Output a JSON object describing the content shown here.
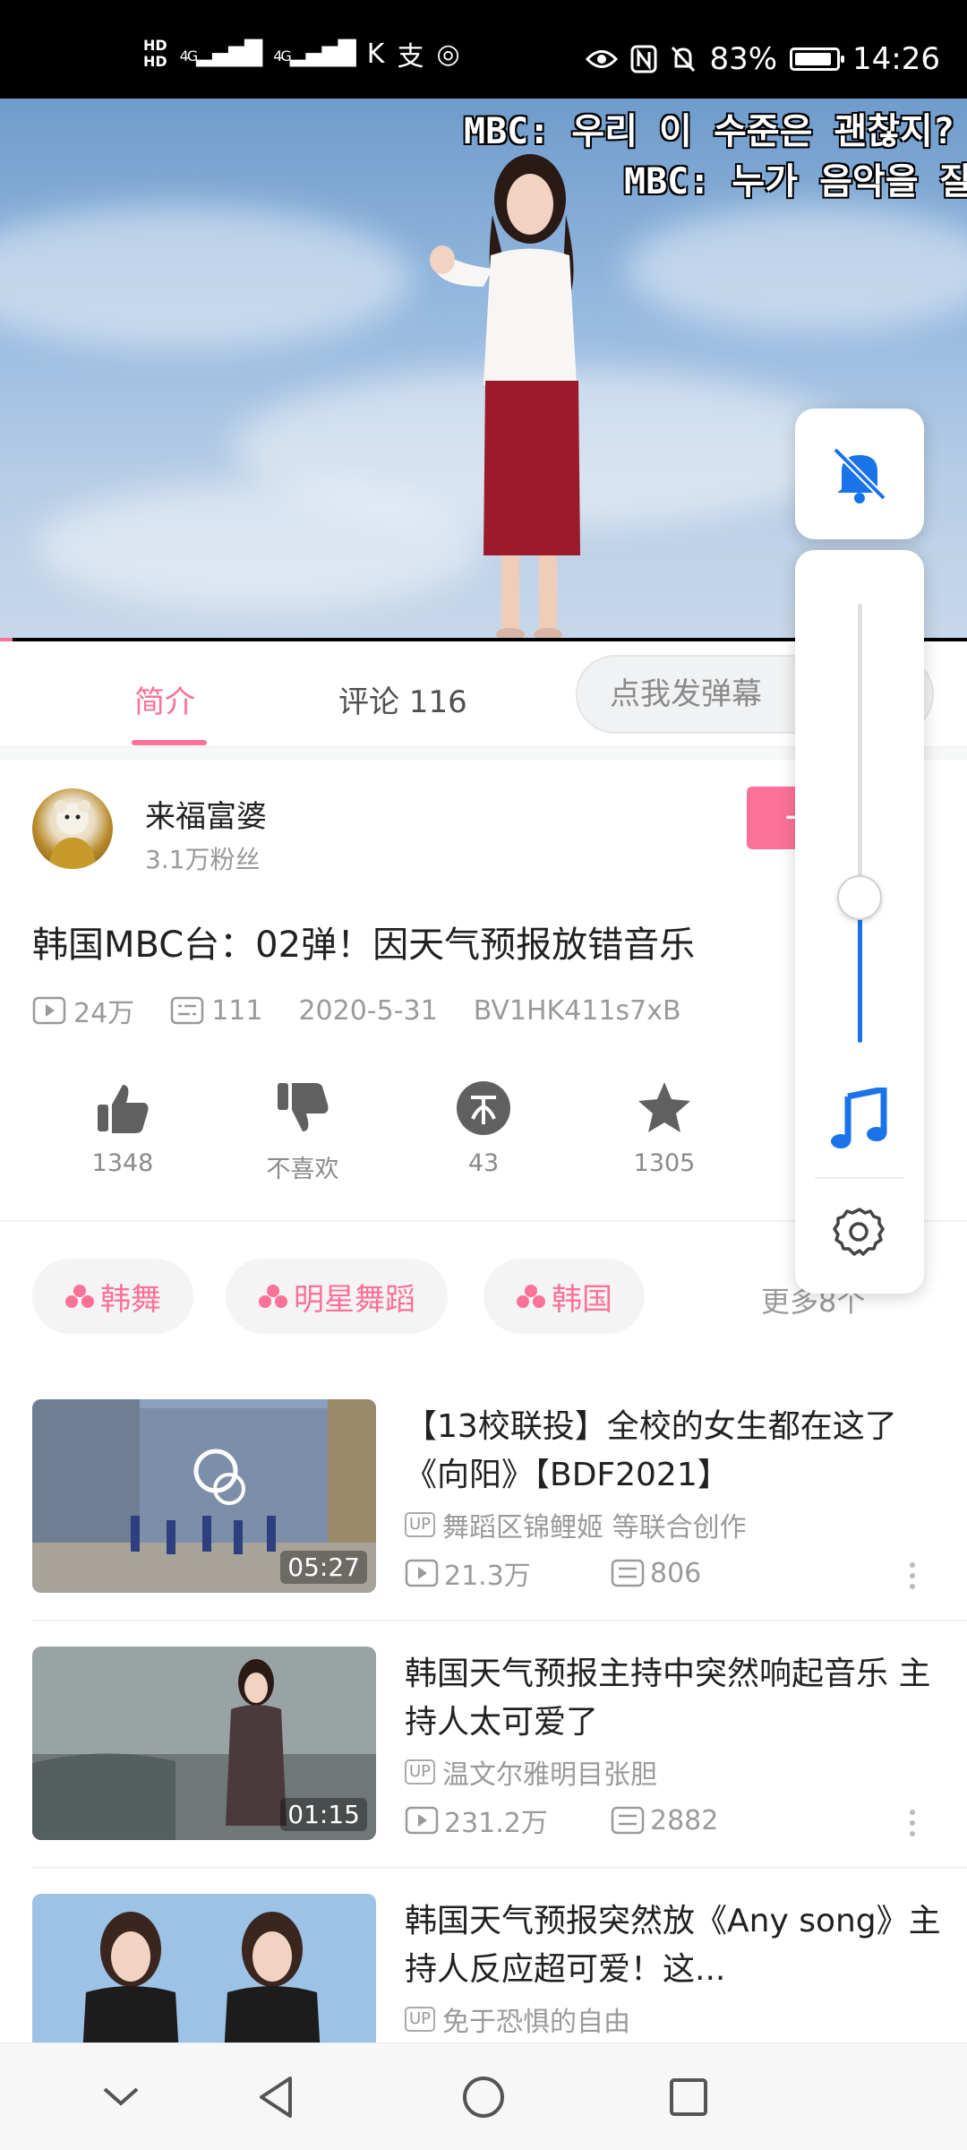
{
  "status_bar": {
    "hd1": "HD",
    "hd2": "HD",
    "net1": "4G",
    "net2": "4G",
    "battery_percent": "83%",
    "time": "14:26"
  },
  "player": {
    "subtitle_line1": "MBC: 우리 이 수준은 괜찮지?",
    "subtitle_line2": "MBC: 누가 음악을 잘",
    "progress_fraction": 0.013
  },
  "tabs": {
    "intro": "简介",
    "comments": "评论 116",
    "danmaku_placeholder": "点我发弹幕"
  },
  "uploader": {
    "name": "来福富婆",
    "fans": "3.1万粉丝",
    "follow_label": "+"
  },
  "video": {
    "title": "韩国MBC台：02弹！因天气预报放错音乐",
    "views": "24万",
    "danmaku": "111",
    "date": "2020-5-31",
    "bvid": "BV1HK411s7xB"
  },
  "actions": {
    "like": "1348",
    "dislike": "不喜欢",
    "coin": "43",
    "favorite": "1305"
  },
  "tags": [
    "韩舞",
    "明星舞蹈",
    "韩国"
  ],
  "more_tags": "更多8个",
  "recommendations": [
    {
      "title": "【13校联投】全校的女生都在这了《向阳》【BDF2021】",
      "up": "舞蹈区锦鲤姬 等联合创作",
      "views": "21.3万",
      "danmaku": "806",
      "duration": "05:27"
    },
    {
      "title": "韩国天气预报主持中突然响起音乐 主持人太可爱了",
      "up": "温文尔雅明目张胆",
      "views": "231.2万",
      "danmaku": "2882",
      "duration": "01:15"
    },
    {
      "title": "韩国天气预报突然放《Any song》主持人反应超可爱！这...",
      "up": "免于恐惧的自由",
      "views": "",
      "danmaku": "",
      "duration": ""
    }
  ],
  "volume_panel": {
    "level_fraction": 0.33,
    "accent_color": "#1a73e8"
  },
  "colors": {
    "brand_pink": "#fb7299",
    "volume_blue": "#1a73e8"
  },
  "icons": [
    "eye-icon",
    "nfc-icon",
    "bell-off-icon",
    "music-note-icon",
    "settings-gear-icon",
    "back-icon",
    "home-icon",
    "recents-icon",
    "collapse-chevron-icon"
  ]
}
